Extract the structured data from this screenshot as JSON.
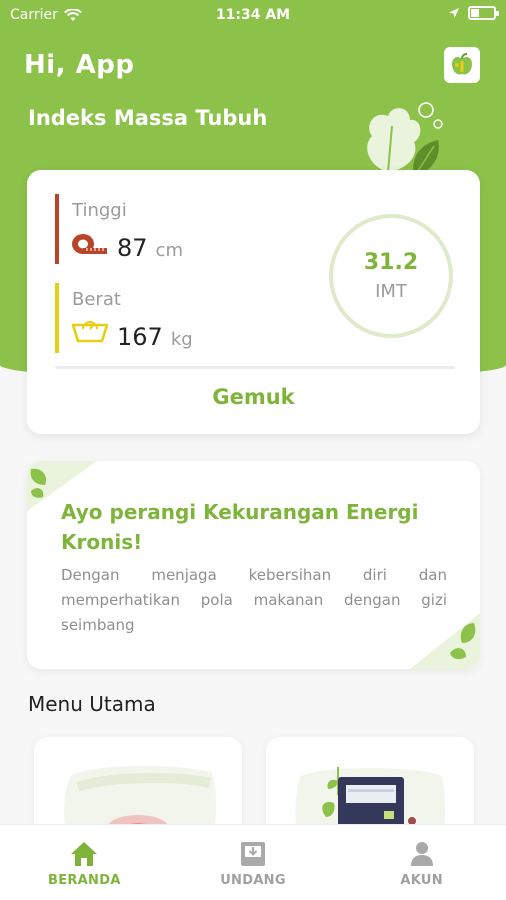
{
  "status_bar": {
    "carrier": "Carrier",
    "time": "11:34 AM"
  },
  "header": {
    "greeting": "Hi, App",
    "subtitle": "Indeks Massa Tubuh"
  },
  "bmi_card": {
    "height_label": "Tinggi",
    "height_value": "87",
    "height_unit": "cm",
    "weight_label": "Berat",
    "weight_value": "167",
    "weight_unit": "kg",
    "imt_value": "31.2",
    "imt_label": "IMT",
    "category": "Gemuk"
  },
  "promo": {
    "title": "Ayo perangi Kekurangan Energi Kronis!",
    "body": "Dengan menjaga kebersihan diri dan memperhatikan pola makanan dengan gizi seimbang"
  },
  "main_menu": {
    "heading": "Menu Utama"
  },
  "tabs": [
    {
      "label": "BERANDA",
      "icon": "home-icon",
      "active": true
    },
    {
      "label": "UNDANG",
      "icon": "invite-download-icon",
      "active": false
    },
    {
      "label": "AKUN",
      "icon": "user-icon",
      "active": false
    }
  ],
  "colors": {
    "primary_green": "#8cc24a",
    "accent_green": "#7fb43a",
    "height_bar": "#b8452a",
    "weight_bar": "#e5cf12"
  }
}
